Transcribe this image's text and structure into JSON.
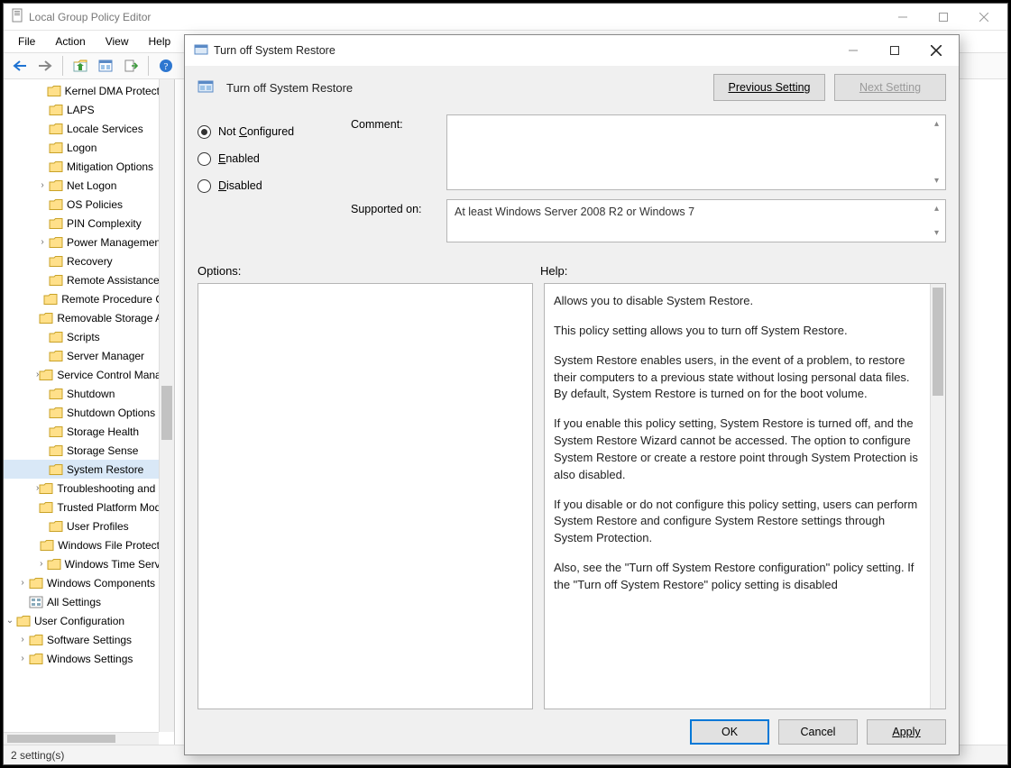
{
  "main_window": {
    "title": "Local Group Policy Editor",
    "menu": {
      "file": "File",
      "action": "Action",
      "view": "View",
      "help": "Help"
    },
    "statusbar": "2 setting(s)"
  },
  "tree": {
    "items": [
      {
        "label": "Kernel DMA Protection",
        "exp": "none",
        "ind": "ind1"
      },
      {
        "label": "LAPS",
        "exp": "none",
        "ind": "ind1"
      },
      {
        "label": "Locale Services",
        "exp": "none",
        "ind": "ind1"
      },
      {
        "label": "Logon",
        "exp": "none",
        "ind": "ind1"
      },
      {
        "label": "Mitigation Options",
        "exp": "none",
        "ind": "ind1"
      },
      {
        "label": "Net Logon",
        "exp": "caret",
        "ind": "ind1"
      },
      {
        "label": "OS Policies",
        "exp": "none",
        "ind": "ind1"
      },
      {
        "label": "PIN Complexity",
        "exp": "none",
        "ind": "ind1"
      },
      {
        "label": "Power Management",
        "exp": "caret",
        "ind": "ind1"
      },
      {
        "label": "Recovery",
        "exp": "none",
        "ind": "ind1"
      },
      {
        "label": "Remote Assistance",
        "exp": "none",
        "ind": "ind1"
      },
      {
        "label": "Remote Procedure Call",
        "exp": "none",
        "ind": "ind1"
      },
      {
        "label": "Removable Storage Access",
        "exp": "none",
        "ind": "ind1"
      },
      {
        "label": "Scripts",
        "exp": "none",
        "ind": "ind1"
      },
      {
        "label": "Server Manager",
        "exp": "none",
        "ind": "ind1"
      },
      {
        "label": "Service Control Manager",
        "exp": "caret",
        "ind": "ind1"
      },
      {
        "label": "Shutdown",
        "exp": "none",
        "ind": "ind1"
      },
      {
        "label": "Shutdown Options",
        "exp": "none",
        "ind": "ind1"
      },
      {
        "label": "Storage Health",
        "exp": "none",
        "ind": "ind1"
      },
      {
        "label": "Storage Sense",
        "exp": "none",
        "ind": "ind1"
      },
      {
        "label": "System Restore",
        "exp": "none",
        "ind": "ind1",
        "selected": true
      },
      {
        "label": "Troubleshooting and Diagnostics",
        "exp": "caret",
        "ind": "ind1"
      },
      {
        "label": "Trusted Platform Module",
        "exp": "none",
        "ind": "ind1"
      },
      {
        "label": "User Profiles",
        "exp": "none",
        "ind": "ind1"
      },
      {
        "label": "Windows File Protection",
        "exp": "none",
        "ind": "ind1"
      },
      {
        "label": "Windows Time Service",
        "exp": "caret",
        "ind": "ind1"
      },
      {
        "label": "Windows Components",
        "exp": "caret",
        "ind": "ind0"
      },
      {
        "label": "All Settings",
        "exp": "none",
        "ind": "ind0",
        "special": "allsettings"
      },
      {
        "label": "User Configuration",
        "exp": "open",
        "ind": "indm"
      },
      {
        "label": "Software Settings",
        "exp": "caret",
        "ind": "ind0",
        "special": "plain"
      },
      {
        "label": "Windows Settings",
        "exp": "caret",
        "ind": "ind0",
        "special": "plain"
      }
    ]
  },
  "dialog": {
    "title": "Turn off System Restore",
    "header": "Turn off System Restore",
    "nav": {
      "prev": "Previous Setting",
      "next": "Next Setting"
    },
    "radios": {
      "not_configured": "Not Configured",
      "enabled": "Enabled",
      "disabled": "Disabled",
      "selected": "not_configured"
    },
    "labels": {
      "comment": "Comment:",
      "supported": "Supported on:",
      "options": "Options:",
      "help": "Help:"
    },
    "supported_text": "At least Windows Server 2008 R2 or Windows 7",
    "help_paragraphs": [
      "Allows you to disable System Restore.",
      "This policy setting allows you to turn off System Restore.",
      "System Restore enables users, in the event of a problem, to restore their computers to a previous state without losing personal data files. By default, System Restore is turned on for the boot volume.",
      "If you enable this policy setting, System Restore is turned off, and the System Restore Wizard cannot be accessed. The option to configure System Restore or create a restore point through System Protection is also disabled.",
      "If you disable or do not configure this policy setting, users can perform System Restore and configure System Restore settings through System Protection.",
      "Also, see the \"Turn off System Restore configuration\" policy setting. If the \"Turn off System Restore\" policy setting is disabled"
    ],
    "buttons": {
      "ok": "OK",
      "cancel": "Cancel",
      "apply": "Apply"
    }
  }
}
